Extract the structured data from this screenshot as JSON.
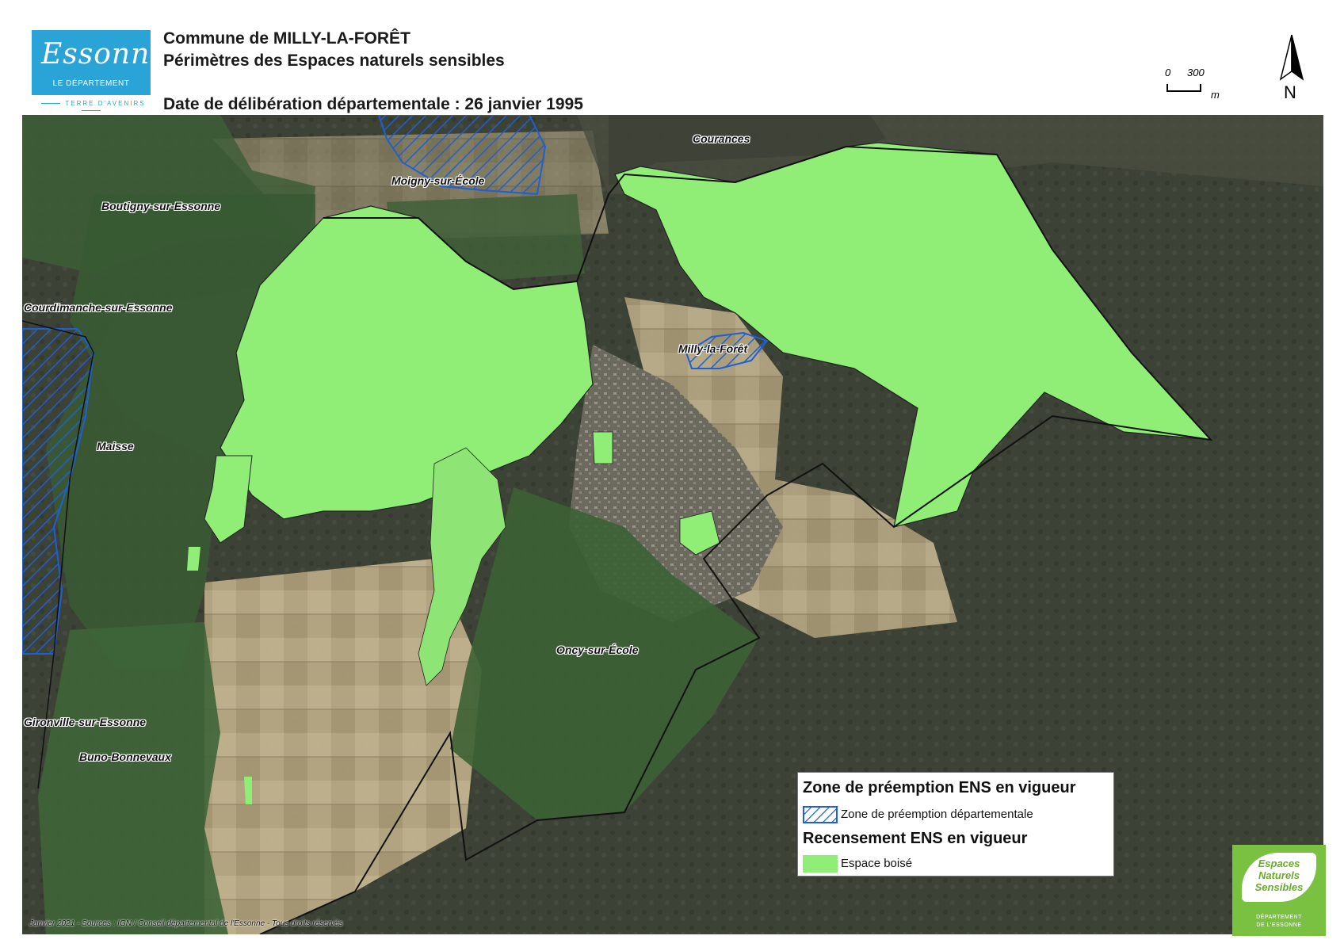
{
  "logo": {
    "wordmark": "Essonne",
    "department_label": "LE DÉPARTEMENT",
    "tagline": "TERRE D'AVENIRS",
    "color": "#2aa3d6"
  },
  "header": {
    "title_commune": "Commune de MILLY-LA-FORÊT",
    "title_subject": "Périmètres des Espaces naturels sensibles",
    "title_date": "Date de délibération départementale : 26 janvier 1995"
  },
  "scale": {
    "zero": "0",
    "max": "300",
    "unit": "m"
  },
  "north": {
    "label": "N",
    "icon": "north-arrow-icon"
  },
  "places": {
    "courances": "Courances",
    "moigny": "Moigny-sur-École",
    "boutigny": "Boutigny-sur-Essonne",
    "courdimanche": "Courdimanche-sur-Essonne",
    "milly": "Milly-la-Forêt",
    "maisse": "Maisse",
    "oncy": "Oncy-sur-École",
    "gironville": "Gironville-sur-Essonne",
    "buno": "Buno-Bonnevaux"
  },
  "legend": {
    "heading_zone": "Zone de préemption ENS en vigueur",
    "item_zone": "Zone de préemption départementale",
    "heading_recensement": "Recensement ENS en vigueur",
    "item_boise": "Espace boisé",
    "color_zone": "#1f5fd1",
    "color_boise": "#90ee77"
  },
  "credits": "Janvier 2021 - Sources : IGN / Conseil départemental de l'Essonne - Tous droits réservés",
  "ens_logo": {
    "line1": "Espaces",
    "line2": "Naturels",
    "line3": "Sensibles",
    "dept1": "DÉPARTEMENT",
    "dept2": "DE L'ESSONNE",
    "color": "#7ac142"
  }
}
